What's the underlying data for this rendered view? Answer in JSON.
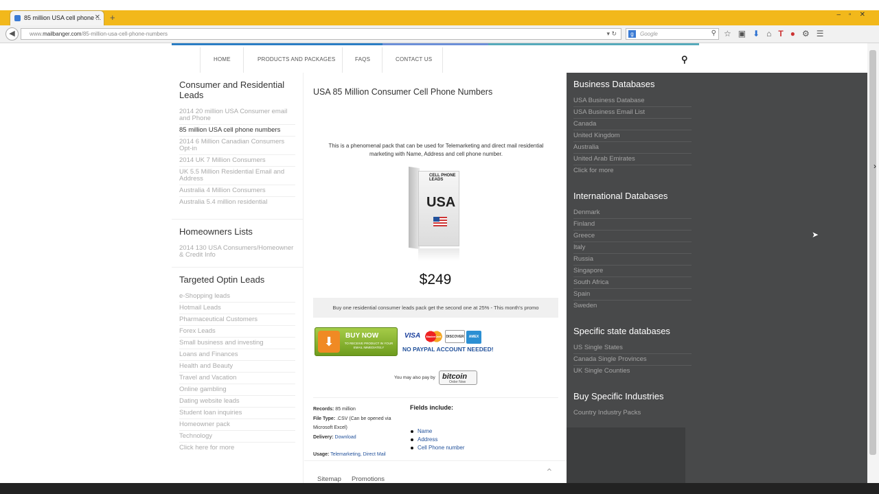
{
  "browser": {
    "tab_title": "85 million USA cell phone ...",
    "url_prefix": "www.",
    "url_domain": "mailbanger.com",
    "url_path": "/85-million-usa-cell-phone-numbers",
    "search_placeholder": "Google"
  },
  "nav": {
    "home": "HOME",
    "products": "PRODUCTS AND PACKAGES",
    "faqs": "FAQS",
    "contact": "CONTACT US"
  },
  "left": {
    "consumer_title": "Consumer and Residential Leads",
    "consumer_items": [
      "2014 20 million USA Consumer email and Phone",
      "85 million USA cell phone numbers",
      "2014 6 Million Canadian Consumers Opt-in",
      "2014 UK 7 Million Consumers",
      "UK 5.5 Million Residential Email and Address",
      "Australia 4 Million Consumers",
      "Australia 5.4 million residential"
    ],
    "homeowners_title": "Homeowners Lists",
    "homeowners_items": [
      "2014 130 USA Consumers/Homeowner & Credit Info"
    ],
    "targeted_title": "Targeted Optin Leads",
    "targeted_items": [
      "e-Shopping leads",
      "Hotmail Leads",
      "Pharmaceutical Customers",
      "Forex Leads",
      "Small business and investing",
      "Loans and Finances",
      "Health and Beauty",
      "Travel and Vacation",
      "Online gambling",
      "Dating website leads",
      "Student loan inquiries",
      "Homeowner pack",
      "Technology",
      "Click here for more"
    ]
  },
  "product": {
    "title": "USA 85 Million Consumer Cell Phone Numbers",
    "description": "This is a phenomenal pack that can be used for Telemarketing and direct mail residential marketing with Name, Address and cell phone number.",
    "box_label": "CELL PHONE LEADS",
    "box_country": "USA",
    "price": "$249",
    "promo": "Buy one residential consumer leads pack get the second one at 25% - This month's promo",
    "buy_now": "BUY NOW",
    "buy_sub": "TO RECEIVE PRODUCT IN YOUR EMAIL IMMEDIATELY",
    "card_visa": "VISA",
    "card_mc": "MasterCard",
    "card_discover": "DISCOVER",
    "card_amex": "AMEX",
    "no_paypal": "NO PAYPAL ACCOUNT NEEDED!",
    "also_pay": "You may also pay by",
    "bitcoin": "bitcoin",
    "bitcoin_sub": "Order Now",
    "records_label": "Records:",
    "records_value": "85 million",
    "filetype_label": "File Type:",
    "filetype_value": ".CSV (Can be opened via Microsoft Excel)",
    "delivery_label": "Delivery:",
    "delivery_value": "Download",
    "usage_label": "Usage:",
    "usage_value": "Telemarketing, Direct Mail",
    "fields_title": "Fields include:",
    "fields": [
      "Name",
      "Address",
      "Cell Phone number"
    ]
  },
  "footer": {
    "sitemap": "Sitemap",
    "promotions": "Promotions"
  },
  "right": {
    "business_title": "Business Databases",
    "business_items": [
      "USA Business Database",
      "USA Business Email List",
      "Canada",
      "United Kingdom",
      "Australia",
      "United Arab Emirates",
      "Click for more"
    ],
    "intl_title": "International Databases",
    "intl_items": [
      "Denmark",
      "Finland",
      "Greece",
      "Italy",
      "Russia",
      "Singapore",
      "South Africa",
      "Spain",
      "Sweden"
    ],
    "state_title": "Specific state databases",
    "state_items": [
      "US Single States",
      "Canada Single Provinces",
      "UK Single Counties"
    ],
    "industry_title": "Buy Specific Industries",
    "industry_items": [
      "Country Industry Packs"
    ]
  },
  "colors": {
    "accent": "#23529b",
    "sidebar": "#48494a",
    "tabbar": "#f2b81b"
  }
}
